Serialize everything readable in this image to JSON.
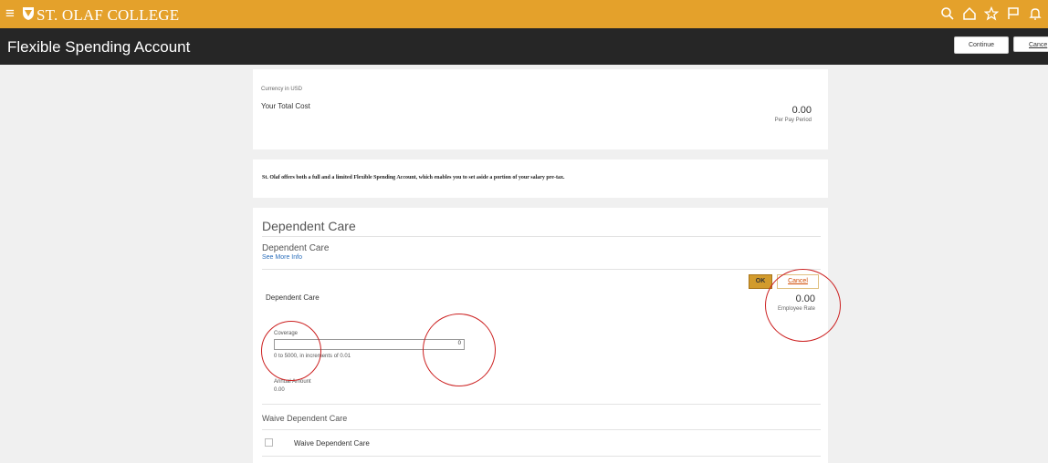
{
  "header": {
    "menu_icon": "hamburger-icon",
    "brand": "ST. OLAF COLLEGE",
    "icons": [
      "search-icon",
      "home-icon",
      "star-icon",
      "flag-icon",
      "bell-icon"
    ]
  },
  "subheader": {
    "title": "Flexible Spending Account",
    "continue_label": "Continue",
    "cancel_label": "Cance"
  },
  "summary": {
    "currency_note": "Currency in USD",
    "total_cost_label": "Your Total Cost",
    "total_cost_value": "0.00",
    "period_label": "Per Pay Period"
  },
  "notice": {
    "text": "St. Olaf offers both a full and a limited Flexible Spending Account, which enables you to set aside a portion of your salary pre-tax."
  },
  "dependent": {
    "section_title": "Dependent Care",
    "plan_title": "Dependent Care",
    "see_more": "See More Info",
    "ok_label": "OK",
    "cancel_label": "Cancel",
    "option_label": "Dependent Care",
    "employee_rate_value": "0.00",
    "employee_rate_label": "Employee Rate",
    "coverage_label": "Coverage",
    "coverage_value": "0",
    "coverage_hint": "0 to 5000, in increments of 0.01",
    "annual_label": "Annual Amount",
    "annual_value": "0.00",
    "waive_title": "Waive Dependent Care",
    "waive_option": "Waive Dependent Care"
  },
  "colors": {
    "brand_gold": "#e4a12b",
    "header_dark": "#262626",
    "annotation_red": "#cc2020",
    "link_blue": "#2a6ebb"
  }
}
